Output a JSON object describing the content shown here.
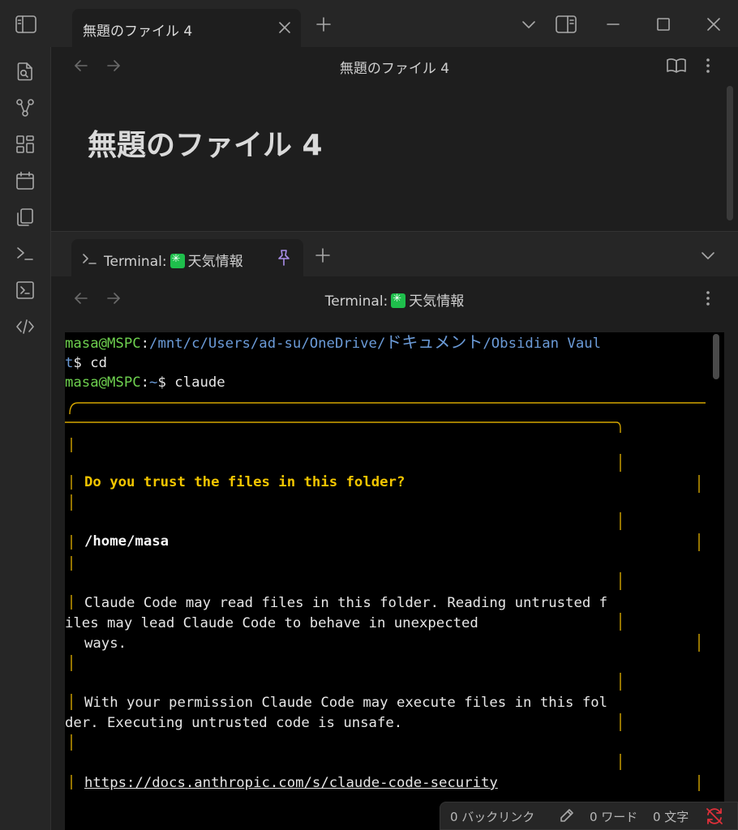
{
  "window": {
    "tab_title": "無題のファイル 4"
  },
  "editor": {
    "header_title": "無題のファイル 4",
    "inline_title": "無題のファイル 4"
  },
  "terminal_pane": {
    "tab_prefix": "Terminal:",
    "tab_name": "天気情報",
    "header_prefix": "Terminal:",
    "header_name": "天気情報",
    "lines": {
      "l1_user": "masa@MSPC",
      "l1_colon": ":",
      "l1_path_a": "/mnt/c/Users/ad-su/OneDrive/",
      "l1_path_jp": "ドキュメント",
      "l1_path_b": "/Obsidian Vaul",
      "l2_path_end": "t",
      "l2_cmd": "$ cd",
      "l3_user": "masa@MSPC",
      "l3_colon": ":",
      "l3_path": "~",
      "l3_cmd": "$ claude",
      "dialog_question": "Do you trust the files in this folder?",
      "dialog_path": "/home/masa",
      "dialog_p1_a": "Claude Code may read files in this folder. Reading untrusted f",
      "dialog_p1_b": "iles may lead Claude Code to behave in unexpected",
      "dialog_p1_c": "ways.",
      "dialog_p2_a": "With your permission Claude Code may execute files in this fol",
      "dialog_p2_b": "der. Executing untrusted code is unsafe.",
      "dialog_link": "https://docs.anthropic.com/s/claude-code-security"
    }
  },
  "statusbar": {
    "backlinks": "0 バックリンク",
    "words": "0 ワード",
    "chars": "0 文字"
  },
  "colors": {
    "prompt_user": "#6ed04f",
    "prompt_path": "#6b9bd8",
    "dialog_border": "#d4a500",
    "dialog_question": "#f2c500",
    "sync_error": "#e0303a",
    "tab_badge": "#1fbf4c"
  }
}
